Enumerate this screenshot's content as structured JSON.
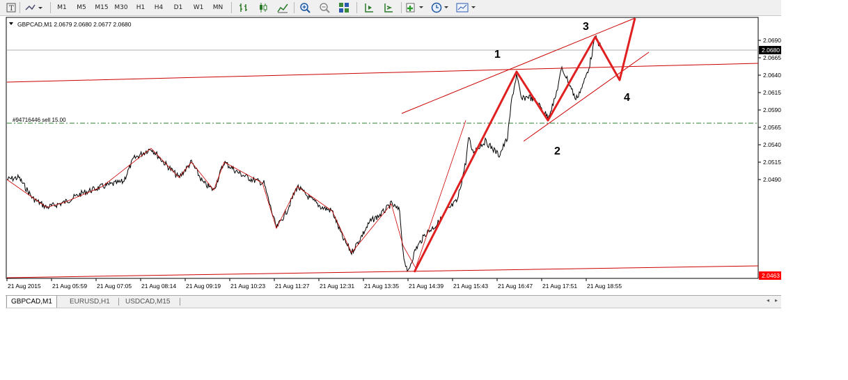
{
  "toolbar": {
    "timeframes": [
      "M1",
      "M5",
      "M15",
      "M30",
      "H1",
      "H4",
      "D1",
      "W1",
      "MN"
    ]
  },
  "chart": {
    "header": "GBPCAD,M1  2.0679 2.0680 2.0677 2.0680",
    "order_label": "#94716446 sell 15.00",
    "price_labels": [
      "2.0690",
      "2.0665",
      "2.0640",
      "2.0615",
      "2.0590",
      "2.0565",
      "2.0540",
      "2.0515",
      "2.0490"
    ],
    "current_price": "2.0680",
    "low_price": "2.0463",
    "time_labels": [
      "21 Aug 2015",
      "21 Aug 05:59",
      "21 Aug 07:05",
      "21 Aug 08:14",
      "21 Aug 09:19",
      "21 Aug 10:23",
      "21 Aug 11:27",
      "21 Aug 12:31",
      "21 Aug 13:35",
      "21 Aug 14:39",
      "21 Aug 15:43",
      "21 Aug 16:47",
      "21 Aug 17:51",
      "21 Aug 18:55"
    ],
    "wave_labels": [
      "1",
      "2",
      "3",
      "4"
    ],
    "colors": {
      "candles": "#000000",
      "trendlines": "#cc0000",
      "waves": "#e02020",
      "order_line": "#2e7d2e",
      "bid_line": "#b0b0b0",
      "price_box": "#000000",
      "low_box": "#ff0000"
    }
  },
  "tabs": [
    "GBPCAD,M1",
    "EURUSD,H1",
    "USDCAD,M15"
  ]
}
